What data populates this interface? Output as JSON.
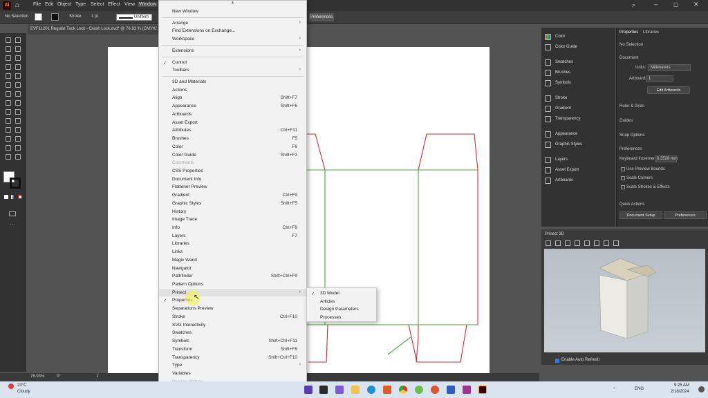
{
  "menubar": {
    "items": [
      "File",
      "Edit",
      "Object",
      "Type",
      "Select",
      "Effect",
      "View",
      "Window"
    ]
  },
  "controlbar": {
    "selection": "No Selection",
    "stroke_label": "Stroke:",
    "stroke_value": "1 pt",
    "brush": "Uniform",
    "preferences": "Preferences"
  },
  "document": {
    "tab_title": "EVF11201 Regular Tuck Lock - Crash Lock.evd* @ 76.93 % (CMYK/",
    "zoom": "76.93%",
    "rotation": "0°",
    "artboard": "1"
  },
  "window_menu": {
    "items": [
      {
        "label": "New Window",
        "shortcut": "",
        "sub": false,
        "check": false,
        "disabled": false
      },
      {
        "sep": true
      },
      {
        "label": "Arrange",
        "shortcut": "",
        "sub": true,
        "check": false,
        "disabled": false
      },
      {
        "label": "Find Extensions on Exchange...",
        "shortcut": "",
        "sub": false,
        "check": false,
        "disabled": false
      },
      {
        "label": "Workspace",
        "shortcut": "",
        "sub": true,
        "check": false,
        "disabled": false
      },
      {
        "sep": true
      },
      {
        "label": "Extensions",
        "shortcut": "",
        "sub": true,
        "check": false,
        "disabled": false
      },
      {
        "sep": true
      },
      {
        "label": "Control",
        "shortcut": "",
        "sub": false,
        "check": true,
        "disabled": false
      },
      {
        "label": "Toolbars",
        "shortcut": "",
        "sub": true,
        "check": false,
        "disabled": false
      },
      {
        "sep": true
      },
      {
        "label": "3D and Materials",
        "shortcut": "",
        "sub": false,
        "check": false,
        "disabled": false
      },
      {
        "label": "Actions",
        "shortcut": "",
        "sub": false,
        "check": false,
        "disabled": false
      },
      {
        "label": "Align",
        "shortcut": "Shift+F7",
        "sub": false,
        "check": false,
        "disabled": false
      },
      {
        "label": "Appearance",
        "shortcut": "Shift+F6",
        "sub": false,
        "check": false,
        "disabled": false
      },
      {
        "label": "Artboards",
        "shortcut": "",
        "sub": false,
        "check": false,
        "disabled": false
      },
      {
        "label": "Asset Export",
        "shortcut": "",
        "sub": false,
        "check": false,
        "disabled": false
      },
      {
        "label": "Attributes",
        "shortcut": "Ctrl+F11",
        "sub": false,
        "check": false,
        "disabled": false
      },
      {
        "label": "Brushes",
        "shortcut": "F5",
        "sub": false,
        "check": false,
        "disabled": false
      },
      {
        "label": "Color",
        "shortcut": "F6",
        "sub": false,
        "check": false,
        "disabled": false
      },
      {
        "label": "Color Guide",
        "shortcut": "Shift+F3",
        "sub": false,
        "check": false,
        "disabled": false
      },
      {
        "label": "Comments",
        "shortcut": "",
        "sub": false,
        "check": false,
        "disabled": true
      },
      {
        "label": "CSS Properties",
        "shortcut": "",
        "sub": false,
        "check": false,
        "disabled": false
      },
      {
        "label": "Document Info",
        "shortcut": "",
        "sub": false,
        "check": false,
        "disabled": false
      },
      {
        "label": "Flattener Preview",
        "shortcut": "",
        "sub": false,
        "check": false,
        "disabled": false
      },
      {
        "label": "Gradient",
        "shortcut": "Ctrl+F9",
        "sub": false,
        "check": false,
        "disabled": false
      },
      {
        "label": "Graphic Styles",
        "shortcut": "Shift+F5",
        "sub": false,
        "check": false,
        "disabled": false
      },
      {
        "label": "History",
        "shortcut": "",
        "sub": false,
        "check": false,
        "disabled": false
      },
      {
        "label": "Image Trace",
        "shortcut": "",
        "sub": false,
        "check": false,
        "disabled": false
      },
      {
        "label": "Info",
        "shortcut": "Ctrl+F8",
        "sub": false,
        "check": false,
        "disabled": false
      },
      {
        "label": "Layers",
        "shortcut": "F7",
        "sub": false,
        "check": false,
        "disabled": false
      },
      {
        "label": "Libraries",
        "shortcut": "",
        "sub": false,
        "check": false,
        "disabled": false
      },
      {
        "label": "Links",
        "shortcut": "",
        "sub": false,
        "check": false,
        "disabled": false
      },
      {
        "label": "Magic Wand",
        "shortcut": "",
        "sub": false,
        "check": false,
        "disabled": false
      },
      {
        "label": "Navigator",
        "shortcut": "",
        "sub": false,
        "check": false,
        "disabled": false
      },
      {
        "label": "Pathfinder",
        "shortcut": "Shift+Ctrl+F9",
        "sub": false,
        "check": false,
        "disabled": false
      },
      {
        "label": "Pattern Options",
        "shortcut": "",
        "sub": false,
        "check": false,
        "disabled": false
      },
      {
        "label": "Prinect",
        "shortcut": "",
        "sub": true,
        "check": false,
        "disabled": false,
        "highlight": true
      },
      {
        "label": "Properties",
        "shortcut": "",
        "sub": false,
        "check": true,
        "disabled": false
      },
      {
        "label": "Separations Preview",
        "shortcut": "",
        "sub": false,
        "check": false,
        "disabled": false
      },
      {
        "label": "Stroke",
        "shortcut": "Ctrl+F10",
        "sub": false,
        "check": false,
        "disabled": false
      },
      {
        "label": "SVG Interactivity",
        "shortcut": "",
        "sub": false,
        "check": false,
        "disabled": false
      },
      {
        "label": "Swatches",
        "shortcut": "",
        "sub": false,
        "check": false,
        "disabled": false
      },
      {
        "label": "Symbols",
        "shortcut": "Shift+Ctrl+F11",
        "sub": false,
        "check": false,
        "disabled": false
      },
      {
        "label": "Transform",
        "shortcut": "Shift+F8",
        "sub": false,
        "check": false,
        "disabled": false
      },
      {
        "label": "Transparency",
        "shortcut": "Shift+Ctrl+F10",
        "sub": false,
        "check": false,
        "disabled": false
      },
      {
        "label": "Type",
        "shortcut": "",
        "sub": true,
        "check": false,
        "disabled": false
      },
      {
        "label": "Variables",
        "shortcut": "",
        "sub": false,
        "check": false,
        "disabled": false
      },
      {
        "label": "Version History",
        "shortcut": "",
        "sub": false,
        "check": false,
        "disabled": true
      }
    ]
  },
  "prinect_submenu": {
    "items": [
      {
        "label": "3D Model",
        "check": true
      },
      {
        "label": "Articles",
        "check": false
      },
      {
        "label": "Design Parameters",
        "check": false
      },
      {
        "label": "Processes",
        "check": false
      }
    ]
  },
  "panels": {
    "items": [
      "Color",
      "Color Guide",
      "Swatches",
      "Brushes",
      "Symbols",
      "Stroke",
      "Gradient",
      "Transparency",
      "Appearance",
      "Graphic Styles",
      "Layers",
      "Asset Export",
      "Artboards"
    ]
  },
  "properties": {
    "tab_properties": "Properties",
    "tab_libraries": "Libraries",
    "no_selection": "No Selection",
    "document": "Document",
    "units_label": "Units:",
    "units_value": "Millimeters",
    "artboard_label": "Artboard:",
    "artboard_value": "1",
    "edit_artboards": "Edit Artboards",
    "ruler_grids": "Ruler & Grids",
    "guides": "Guides",
    "snap_options": "Snap Options",
    "preferences": "Preferences",
    "keyboard_increment_label": "Keyboard Increment:",
    "keyboard_increment_value": "0.3528 mm",
    "use_preview_bounds": "Use Preview Bounds",
    "scale_corners": "Scale Corners",
    "scale_strokes": "Scale Strokes & Effects",
    "quick_actions": "Quick Actions",
    "document_setup": "Document Setup",
    "preferences_btn": "Preferences"
  },
  "prinect_panel": {
    "title": "Prinect 3D",
    "auto_refresh": "Enable Auto Refresh"
  },
  "taskbar": {
    "weather_temp": "23°C",
    "weather_desc": "Cloudy",
    "lang": "ENG",
    "time": "9:25 AM",
    "date": "2/18/2024"
  },
  "colors": {
    "cut_line": "#d42a2a",
    "crease_line": "#4aa83a",
    "menu_bg": "#f2f2f2",
    "ui_dark": "#323232"
  }
}
